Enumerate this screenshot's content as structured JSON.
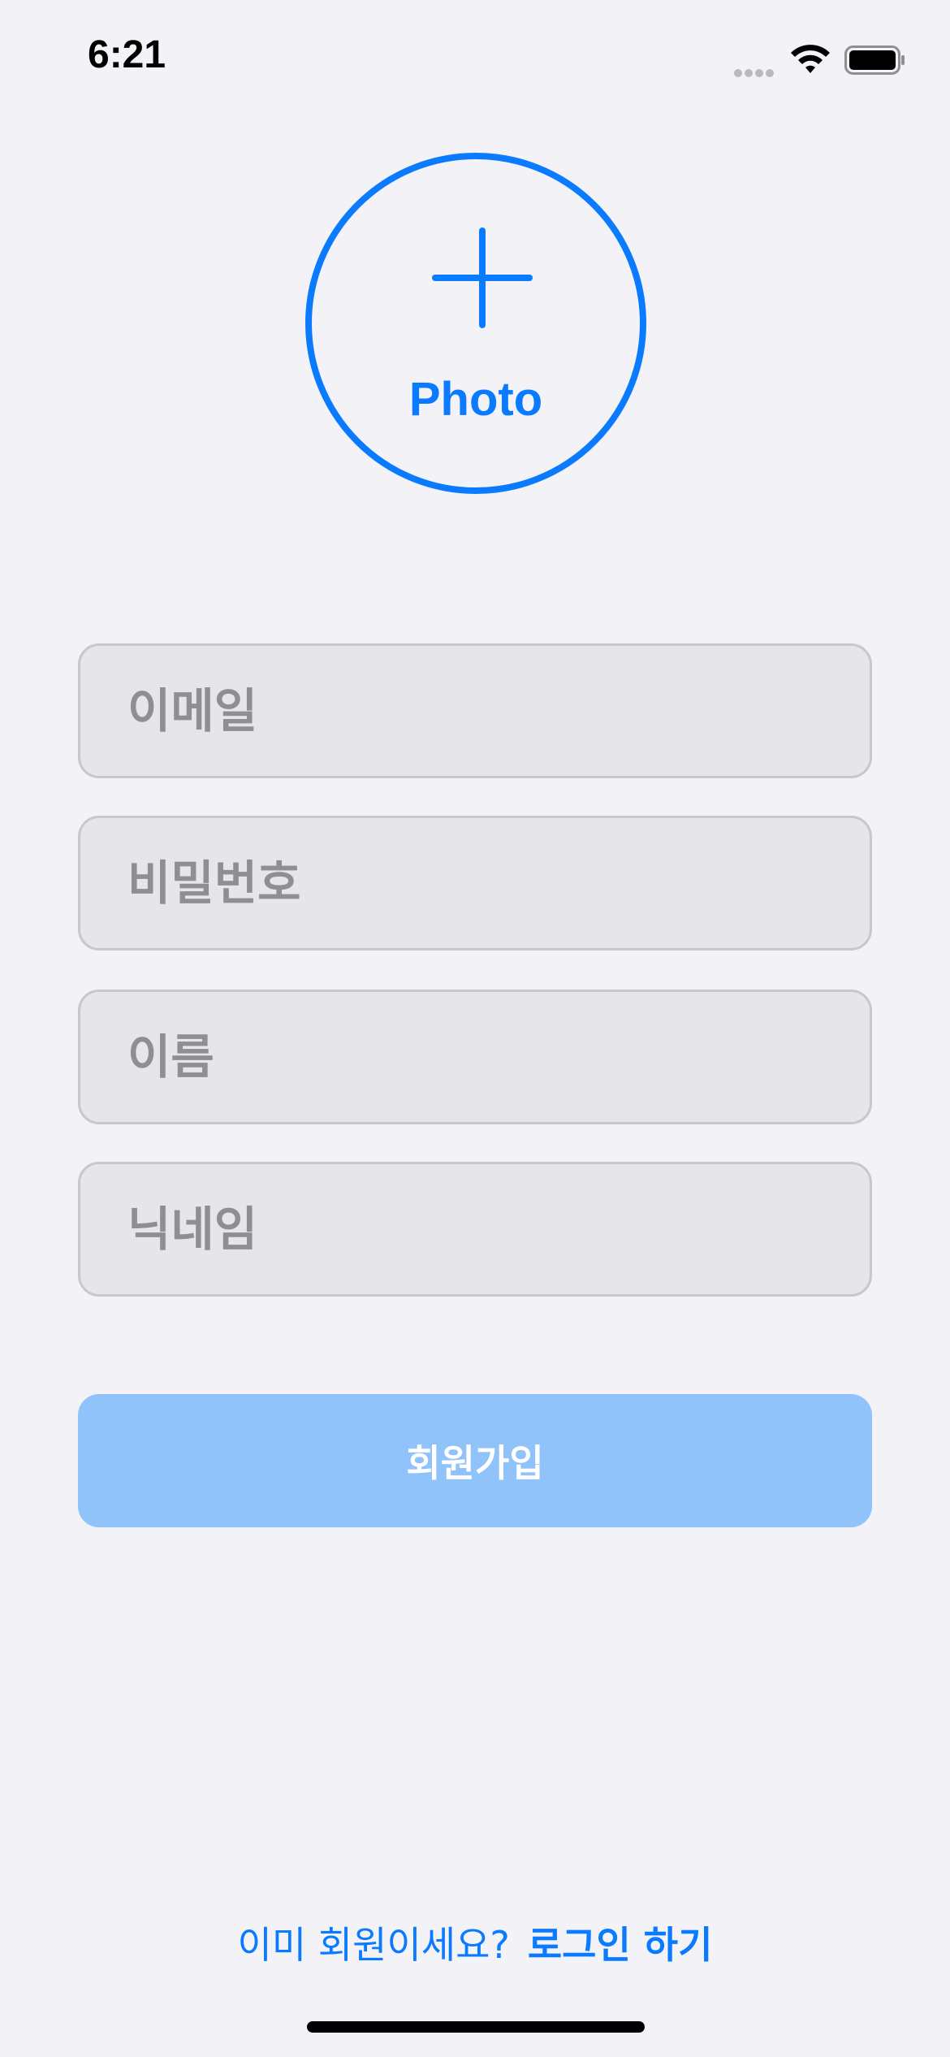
{
  "status_bar": {
    "time": "6:21",
    "signal_icon": "cellular-signal-icon",
    "wifi_icon": "wifi-icon",
    "battery_icon": "battery-icon"
  },
  "photo_picker": {
    "label": "Photo",
    "icon": "plus-icon",
    "accent_color": "#0A7AFF"
  },
  "form": {
    "email": {
      "placeholder": "이메일",
      "value": ""
    },
    "password": {
      "placeholder": "비밀번호",
      "value": ""
    },
    "name": {
      "placeholder": "이름",
      "value": ""
    },
    "nickname": {
      "placeholder": "닉네임",
      "value": ""
    }
  },
  "signup_button": {
    "label": "회원가입",
    "state": "disabled",
    "color": "#91C3FB"
  },
  "footer": {
    "prompt": "이미 회원이세요?",
    "login_link": "로그인 하기"
  },
  "colors": {
    "background": "#F2F2F7",
    "field_background": "#E6E5EA",
    "placeholder": "#8E8E93"
  }
}
